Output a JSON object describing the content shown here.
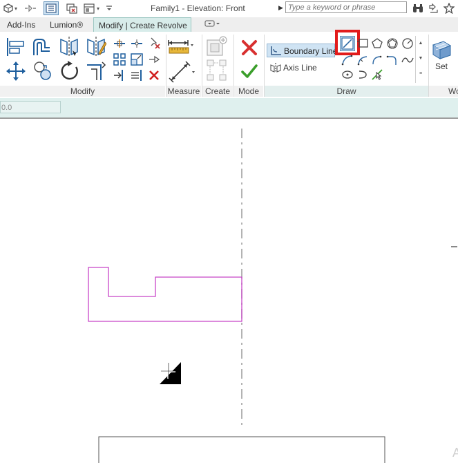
{
  "titlebar": {
    "title": "Family1 - Elevation: Front",
    "search_placeholder": "Type a keyword or phrase",
    "icons": [
      "app-icon",
      "open-icon",
      "thin-lines-icon",
      "close-hidden-icon",
      "switch-windows-icon",
      "customize-qat-icon",
      "binoculars-icon",
      "signin-icon",
      "star-icon"
    ]
  },
  "tabs": {
    "add_ins": "Add-Ins",
    "lumion": "Lumion®",
    "modify_create_revolve": "Modify | Create Revolve"
  },
  "panels": {
    "modify": "Modify",
    "measure": "Measure",
    "create": "Create",
    "mode": "Mode",
    "draw": "Draw",
    "set": "Set",
    "work_plane_cut": "Wo"
  },
  "draw": {
    "boundary_line": "Boundary Line",
    "axis_line": "Axis Line"
  },
  "options_bar": {
    "value": "0.0"
  },
  "colors": {
    "sketch_magenta": "#c844c8",
    "highlight_red": "#e21b1b",
    "active_tab": "#d8ecea",
    "options_bar": "#dff0ee"
  }
}
